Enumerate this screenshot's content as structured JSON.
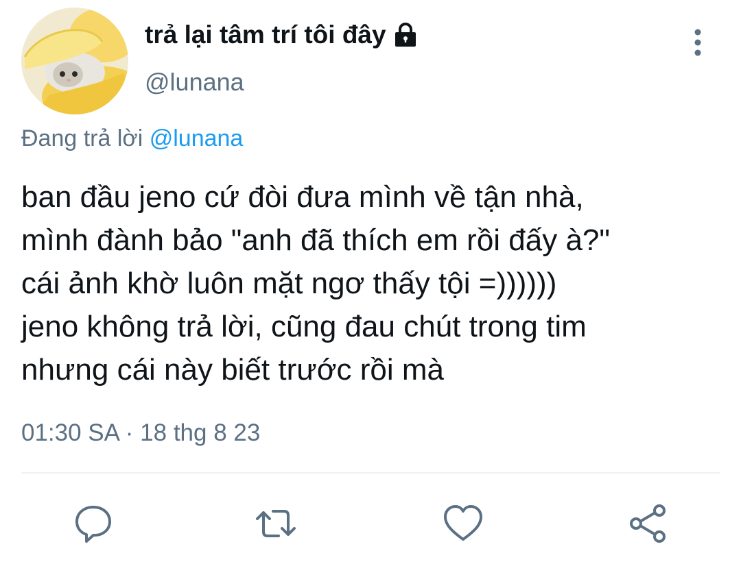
{
  "user": {
    "display_name": "trả lại tâm trí tôi đây",
    "handle": "@lunana",
    "protected": true
  },
  "reply": {
    "prefix": "Đang trả lời",
    "handle": "@lunana"
  },
  "tweet": {
    "lines": [
      "ban đầu jeno cứ đòi đưa mình về tận nhà,",
      "mình đành bảo \"anh đã thích em rồi đấy à?\"",
      "cái ảnh khờ luôn mặt ngơ thấy tội =))))))",
      "jeno không trả lời, cũng đau chút trong tim",
      "nhưng cái này biết trước rồi mà"
    ],
    "timestamp": "01:30 SA · 18 thg 8 23"
  },
  "icons": {
    "lock": "lock-icon",
    "more": "more-vertical-icon",
    "reply": "reply-icon",
    "retweet": "retweet-icon",
    "like": "heart-icon",
    "share": "share-icon"
  },
  "colors": {
    "text": "#0f1419",
    "muted": "#5b7083",
    "link": "#1d9bf0",
    "divider": "#eff3f4"
  }
}
